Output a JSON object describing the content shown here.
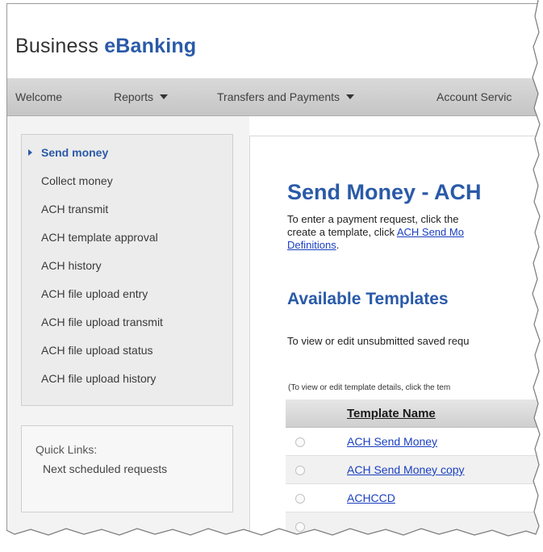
{
  "brand": {
    "part1": "Business ",
    "part2": "eBanking"
  },
  "topnav": {
    "items": [
      {
        "label": "Welcome"
      },
      {
        "label": "Reports"
      },
      {
        "label": "Transfers and Payments"
      },
      {
        "label": "Account Servic"
      }
    ]
  },
  "sidebar": {
    "items": [
      {
        "label": "Send money"
      },
      {
        "label": "Collect money"
      },
      {
        "label": "ACH transmit"
      },
      {
        "label": "ACH template approval"
      },
      {
        "label": "ACH history"
      },
      {
        "label": "ACH file upload entry"
      },
      {
        "label": "ACH file upload transmit"
      },
      {
        "label": "ACH file upload status"
      },
      {
        "label": "ACH file upload history"
      }
    ]
  },
  "quick_links": {
    "label": "Quick Links:",
    "item": "Next scheduled requests"
  },
  "main": {
    "title": "Send Money - ACH",
    "intro": {
      "line1": "To enter a payment request, click the",
      "line2_pre": "create a template, click ",
      "line2_link": "ACH Send Mo",
      "line3_link": "Definitions",
      "line3_post": "."
    },
    "available_title": "Available Templates",
    "view_text": "To view or edit unsubmitted saved requ",
    "small_note": "(To view or edit template details, click the tem",
    "table": {
      "header": "Template Name",
      "rows": [
        {
          "name": "ACH Send Money"
        },
        {
          "name": "ACH Send Money copy"
        },
        {
          "name": "ACHCCD"
        }
      ]
    }
  },
  "colors": {
    "accent": "#2a5aa8",
    "link": "#1a3fc0",
    "nav_bg": "#d0d0d0"
  }
}
